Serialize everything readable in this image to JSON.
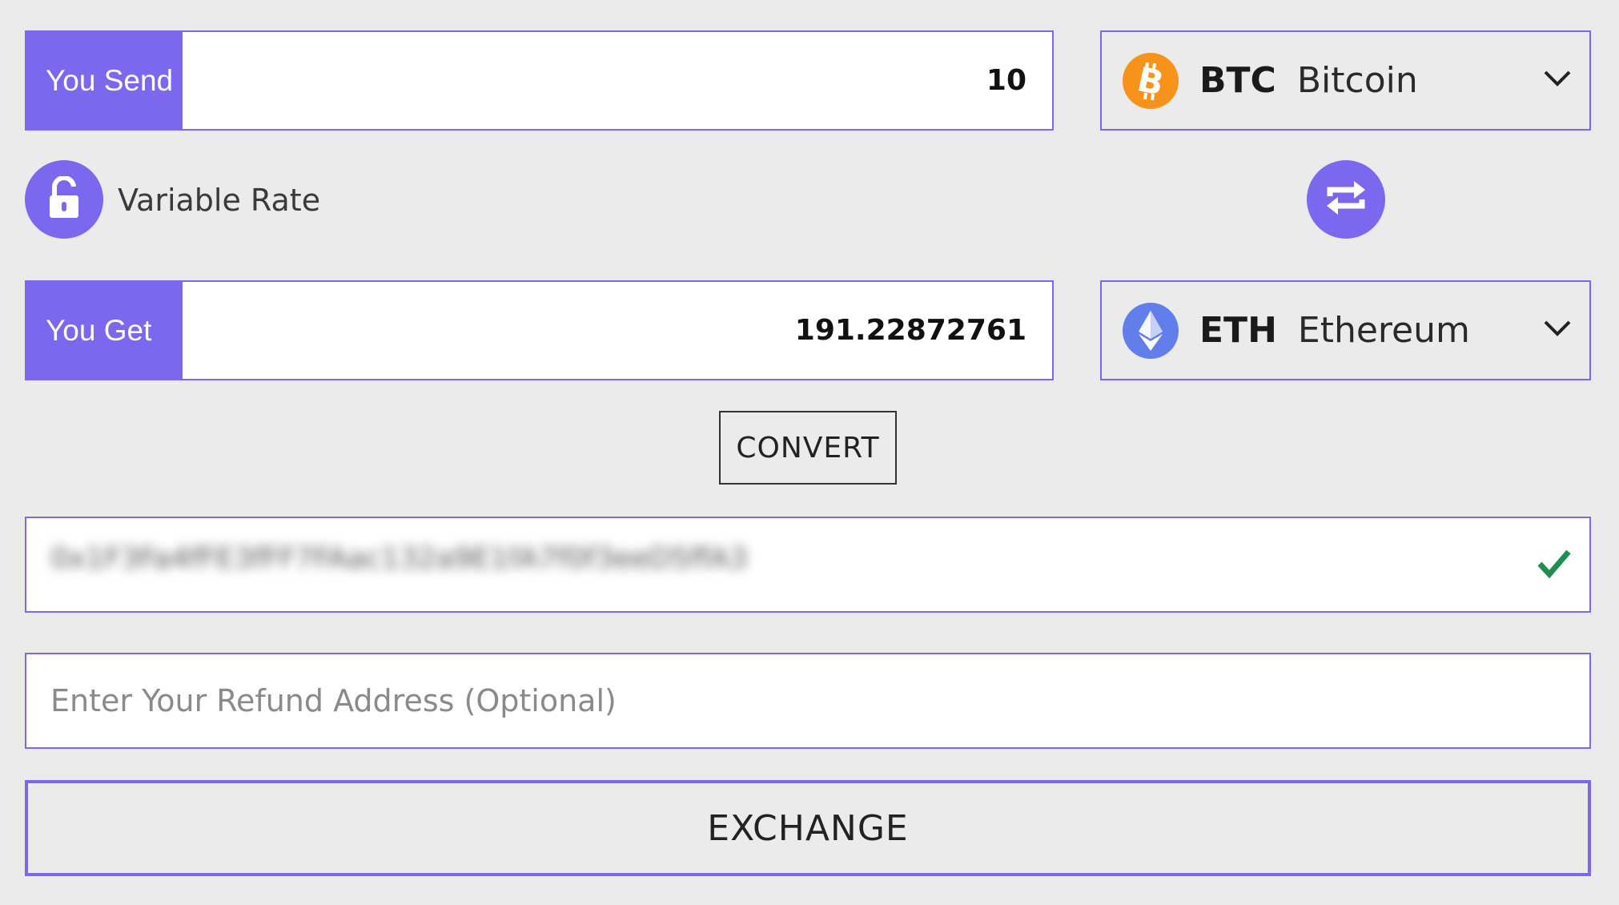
{
  "send": {
    "label": "You Send",
    "value": "10"
  },
  "get": {
    "label": "You Get",
    "value": "191.22872761"
  },
  "from_currency": {
    "code": "BTC",
    "name": "Bitcoin",
    "icon": "bitcoin-icon",
    "color": "#f7931a"
  },
  "to_currency": {
    "code": "ETH",
    "name": "Ethereum",
    "icon": "ethereum-icon",
    "color": "#627eea"
  },
  "rate": {
    "label": "Variable Rate",
    "icon": "unlock-icon"
  },
  "swap": {
    "icon": "swap-arrows-icon"
  },
  "convert": {
    "label": "CONVERT"
  },
  "recipient": {
    "value": "0x1F3Fa4fFE3fFF7FAac132a9E1fA7f0f3eeD5ffA3"
  },
  "refund": {
    "placeholder": "Enter Your Refund Address (Optional)"
  },
  "exchange": {
    "label": "EXCHANGE"
  },
  "colors": {
    "accent": "#7b68ee",
    "background": "#ebebeb",
    "valid": "#1e8f4e"
  }
}
